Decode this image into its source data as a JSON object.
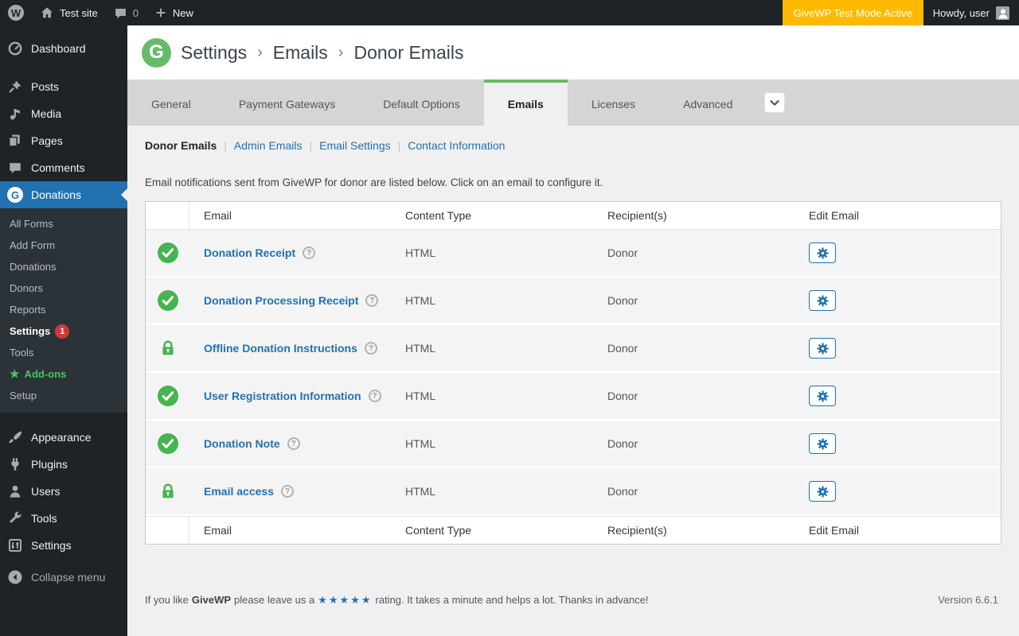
{
  "admin_bar": {
    "wp_logo_letter": "W",
    "site_name": "Test site",
    "comment_count": "0",
    "new_label": "New",
    "test_mode_badge": "GiveWP Test Mode Active",
    "howdy_text": "Howdy, user"
  },
  "sidebar": {
    "menu_top": [
      {
        "label": "Dashboard"
      },
      {
        "label": "Posts"
      },
      {
        "label": "Media"
      },
      {
        "label": "Pages"
      },
      {
        "label": "Comments"
      },
      {
        "label": "Donations"
      }
    ],
    "donations_submenu": [
      {
        "label": "All Forms"
      },
      {
        "label": "Add Form"
      },
      {
        "label": "Donations"
      },
      {
        "label": "Donors"
      },
      {
        "label": "Reports"
      },
      {
        "label": "Settings",
        "badge": "1"
      },
      {
        "label": "Tools"
      },
      {
        "label": "Add-ons",
        "star": "★"
      },
      {
        "label": "Setup"
      }
    ],
    "menu_bottom": [
      {
        "label": "Appearance"
      },
      {
        "label": "Plugins"
      },
      {
        "label": "Users"
      },
      {
        "label": "Tools"
      },
      {
        "label": "Settings"
      }
    ],
    "collapse_label": "Collapse menu",
    "give_logo_letter": "G"
  },
  "header": {
    "logo_letter": "G",
    "crumb1": "Settings",
    "crumb2": "Emails",
    "crumb3": "Donor Emails",
    "separator": "›"
  },
  "tabs": {
    "general": "General",
    "payment_gateways": "Payment Gateways",
    "default_options": "Default Options",
    "emails": "Emails",
    "licenses": "Licenses",
    "advanced": "Advanced"
  },
  "subnav": {
    "donor_emails": "Donor Emails",
    "admin_emails": "Admin Emails",
    "email_settings": "Email Settings",
    "contact_information": "Contact Information",
    "separator": "|"
  },
  "description": "Email notifications sent from GiveWP for donor are listed below. Click on an email to configure it.",
  "table": {
    "help_glyph": "?",
    "header": {
      "email": "Email",
      "content_type": "Content Type",
      "recipients": "Recipient(s)",
      "edit_email": "Edit Email"
    },
    "rows": [
      {
        "status": "enabled",
        "email": "Donation Receipt",
        "content_type": "HTML",
        "recipients": "Donor"
      },
      {
        "status": "enabled",
        "email": "Donation Processing Receipt",
        "content_type": "HTML",
        "recipients": "Donor"
      },
      {
        "status": "locked",
        "email": "Offline Donation Instructions",
        "content_type": "HTML",
        "recipients": "Donor"
      },
      {
        "status": "enabled",
        "email": "User Registration Information",
        "content_type": "HTML",
        "recipients": "Donor"
      },
      {
        "status": "enabled",
        "email": "Donation Note",
        "content_type": "HTML",
        "recipients": "Donor"
      },
      {
        "status": "locked",
        "email": "Email access",
        "content_type": "HTML",
        "recipients": "Donor"
      }
    ]
  },
  "footer": {
    "prefix": "If you like",
    "brand": "GiveWP",
    "middle": "please leave us a",
    "stars": "★★★★★",
    "suffix": "rating. It takes a minute and helps a lot. Thanks in advance!",
    "version": "Version 6.6.1"
  },
  "colors": {
    "accent_blue": "#2271b1",
    "give_green": "#66bb6a",
    "status_green": "#46b450",
    "test_mode_orange": "#ffb900",
    "badge_red": "#d63638",
    "admin_dark": "#1d2327"
  }
}
